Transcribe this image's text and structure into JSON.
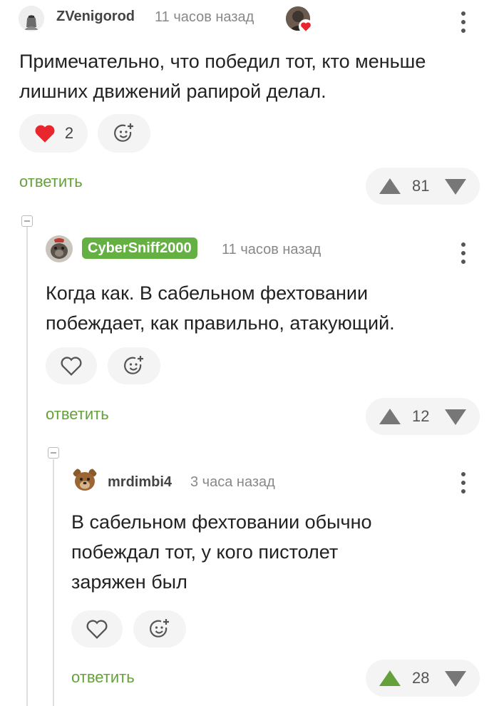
{
  "comments": [
    {
      "username": "ZVenigorod",
      "time": "11 часов назад",
      "text": "Примечательно, что победил тот, кто меньше лишних движений рапирой делал.",
      "likes": "2",
      "rating": "81",
      "reply_label": "ответить"
    },
    {
      "username": "CyberSniff2000",
      "time": "11 часов назад",
      "text": "Когда как. В сабельном фехтовании побеждает, как правильно, атакующий.",
      "rating": "12",
      "reply_label": "ответить"
    },
    {
      "username": "mrdimbi4",
      "time": "3 часа назад",
      "text": "В сабельном фехтовании обычно побеждал тот, у кого пистолет заряжен был",
      "rating": "28",
      "reply_label": "ответить"
    }
  ],
  "colors": {
    "accent_green": "#64a13a",
    "badge_green": "#64b042",
    "like_red": "#e8262e",
    "vote_gray": "#777777"
  },
  "icons": [
    "like-heart-icon",
    "add-reaction-icon",
    "upvote-arrow-icon",
    "downvote-arrow-icon",
    "more-menu-icon",
    "collapse-thread-icon"
  ]
}
